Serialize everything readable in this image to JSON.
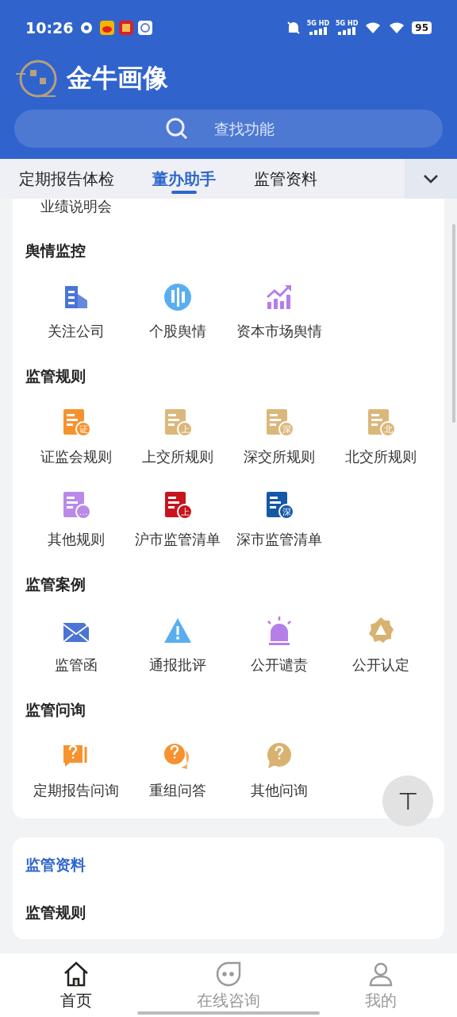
{
  "status_bar": {
    "time": "10:26",
    "signals": [
      "5G HD",
      "5G HD"
    ],
    "battery": "95"
  },
  "header": {
    "title": "金牛画像",
    "search": {
      "placeholder": "查找功能"
    }
  },
  "tabs": [
    {
      "label": "定期报告体检",
      "selected": false
    },
    {
      "label": "董办助手",
      "selected": true
    },
    {
      "label": "监管资料",
      "selected": false
    }
  ],
  "top_item": {
    "label": "业绩说明会"
  },
  "sections": [
    {
      "title": "舆情监控",
      "items": [
        {
          "label": "关注公司",
          "kind": "building",
          "color": "#4a74d6"
        },
        {
          "label": "个股舆情",
          "kind": "candles",
          "color": "#5aaef0"
        },
        {
          "label": "资本市场舆情",
          "kind": "chart",
          "color": "#b57ee8"
        }
      ]
    },
    {
      "title": "监管规则",
      "items": [
        {
          "label": "证监会规则",
          "kind": "doc",
          "color": "#f7922e",
          "badge": "证"
        },
        {
          "label": "上交所规则",
          "kind": "doc",
          "color": "#dcb77a",
          "badge": "上"
        },
        {
          "label": "深交所规则",
          "kind": "doc",
          "color": "#dcb77a",
          "badge": "深"
        },
        {
          "label": "北交所规则",
          "kind": "doc",
          "color": "#dcb77a",
          "badge": "北"
        },
        {
          "label": "其他规则",
          "kind": "doc",
          "color": "#b98ae8",
          "badge": "…"
        },
        {
          "label": "沪市监管清单",
          "kind": "doc",
          "color": "#c8141c",
          "badge": "上"
        },
        {
          "label": "深市监管清单",
          "kind": "doc",
          "color": "#1458a8",
          "badge": "深"
        }
      ]
    },
    {
      "title": "监管案例",
      "items": [
        {
          "label": "监管函",
          "kind": "envelope",
          "color": "#4a74d6"
        },
        {
          "label": "通报批评",
          "kind": "warning",
          "color": "#5aaef0"
        },
        {
          "label": "公开谴责",
          "kind": "siren",
          "color": "#b57ee8"
        },
        {
          "label": "公开认定",
          "kind": "seal",
          "color": "#d8b270"
        }
      ]
    },
    {
      "title": "监管问询",
      "items": [
        {
          "label": "定期报告问询",
          "kind": "ask-doc",
          "color": "#f7922e"
        },
        {
          "label": "重组问答",
          "kind": "ask-chat",
          "color": "#f7922e"
        },
        {
          "label": "其他问询",
          "kind": "ask",
          "color": "#d8b270"
        }
      ]
    }
  ],
  "second_card": {
    "title": "监管资料",
    "section": "监管规则"
  },
  "scroll_top": {
    "label": "⊤"
  },
  "bottom_nav": [
    {
      "label": "首页",
      "kind": "home",
      "selected": true
    },
    {
      "label": "在线咨询",
      "kind": "chat",
      "selected": false
    },
    {
      "label": "我的",
      "kind": "person",
      "selected": false
    }
  ]
}
